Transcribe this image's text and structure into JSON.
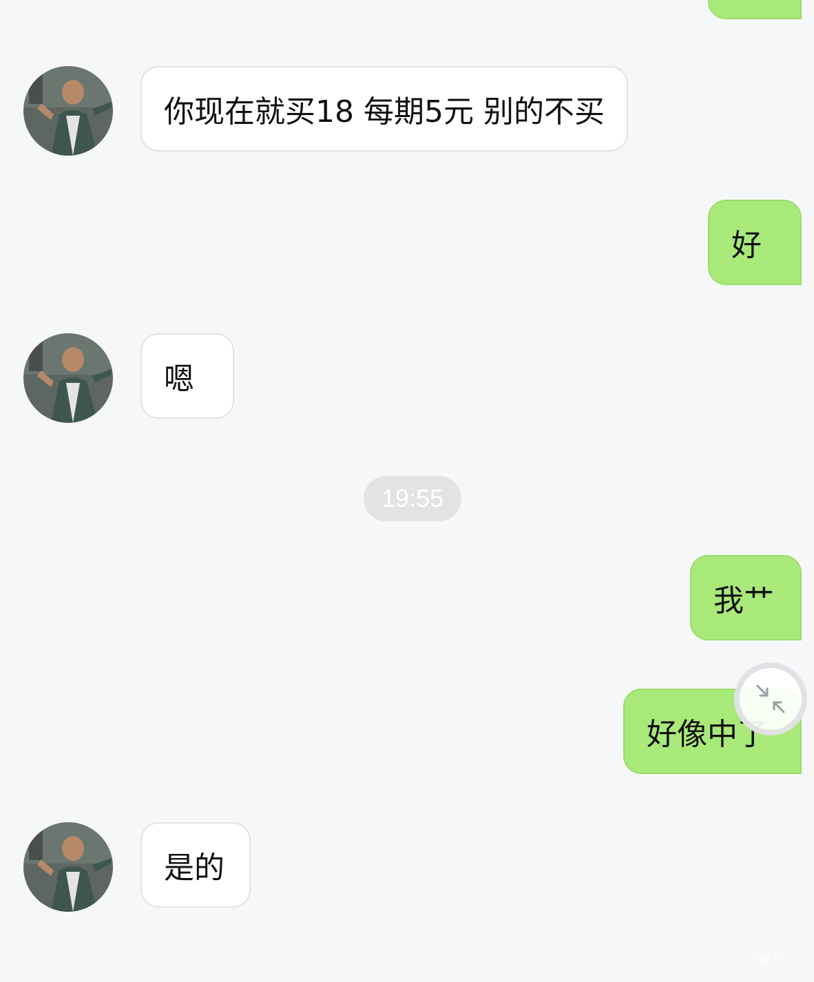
{
  "chat": {
    "colors": {
      "background": "#f6f7f9",
      "incoming_bubble": "#ffffff",
      "outgoing_bubble": "#a9e979",
      "timestamp_pill": "#e2e3e5"
    },
    "messages": [
      {
        "direction": "outgoing",
        "text": ""
      },
      {
        "direction": "incoming",
        "text": "你现在就买18 每期5元 别的不买",
        "avatar": "contact-avatar"
      },
      {
        "direction": "outgoing",
        "text": "好"
      },
      {
        "direction": "incoming",
        "text": "嗯",
        "avatar": "contact-avatar"
      },
      {
        "direction": "outgoing",
        "text": "我艹"
      },
      {
        "direction": "outgoing",
        "text": "好像中了"
      },
      {
        "direction": "incoming",
        "text": "是的",
        "avatar": "contact-avatar"
      }
    ],
    "timestamp": "19:55",
    "floating_button_icon": "collapse-arrows-icon",
    "watermark": "hdz.bf"
  }
}
